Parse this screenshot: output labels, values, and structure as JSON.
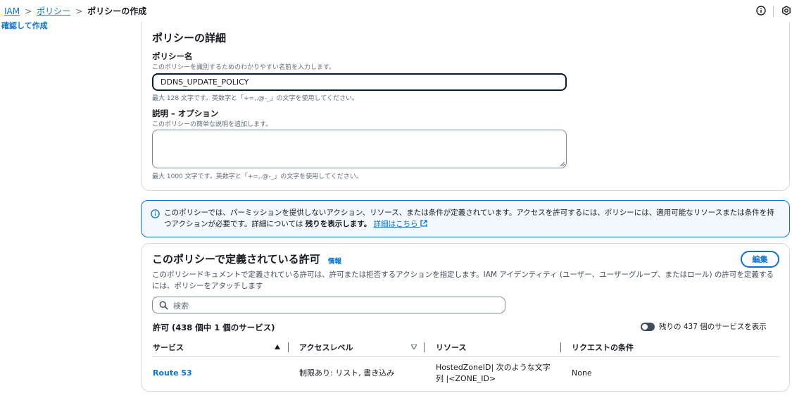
{
  "breadcrumb": {
    "items": [
      "IAM",
      "ポリシー"
    ],
    "current": "ポリシーの作成"
  },
  "sidebar": {
    "step": "確認して作成"
  },
  "details": {
    "title": "ポリシーの詳細",
    "name_label": "ポリシー名",
    "name_desc": "このポリシーを識別するためのわかりやすい名前を入力します。",
    "name_value": "DDNS_UPDATE_POLICY",
    "name_constraint": "最大 128 文字です。英数字と「+=,.@-_」の文字を使用してください。",
    "desc_label": "説明 – オプション",
    "desc_desc": "このポリシーの簡単な説明を追加します。",
    "desc_value": "",
    "desc_constraint": "最大 1000 文字です。英数字と「+=,.@-_」の文字を使用してください。"
  },
  "alert": {
    "text1": "このポリシーでは、パーミッションを提供しないアクション、リソース、または条件が定義されています。アクセスを許可するには、ポリシーには、適用可能なリソースまたは条件を持つアクションが必要です。詳細については ",
    "bold": "残りを表示します。",
    "link": "詳細はこちら"
  },
  "permissions": {
    "title": "このポリシーで定義されている許可",
    "info": "情報",
    "edit": "編集",
    "description": "このポリシードキュメントで定義されている許可は、許可または拒否するアクションを指定します。IAM アイデンティティ (ユーザー、ユーザーグループ、またはロール) の許可を定義するには、ポリシーをアタッチします",
    "search_placeholder": "検索",
    "count_title": "許可 (438 個中 1 個のサービス)",
    "toggle_label": "残りの 437 個のサービスを表示",
    "columns": [
      "サービス",
      "アクセスレベル",
      "リソース",
      "リクエストの条件"
    ],
    "rows": [
      {
        "service": "Route 53",
        "access": "制限あり: リスト, 書き込み",
        "resource_line1": "HostedZoneID| 次のような文字",
        "resource_line2": "列 |<ZONE_ID>",
        "condition": "None"
      }
    ]
  },
  "colors": {
    "link": "#0972d3",
    "alert_bg": "#f2f8fd",
    "text": "#16191f"
  }
}
